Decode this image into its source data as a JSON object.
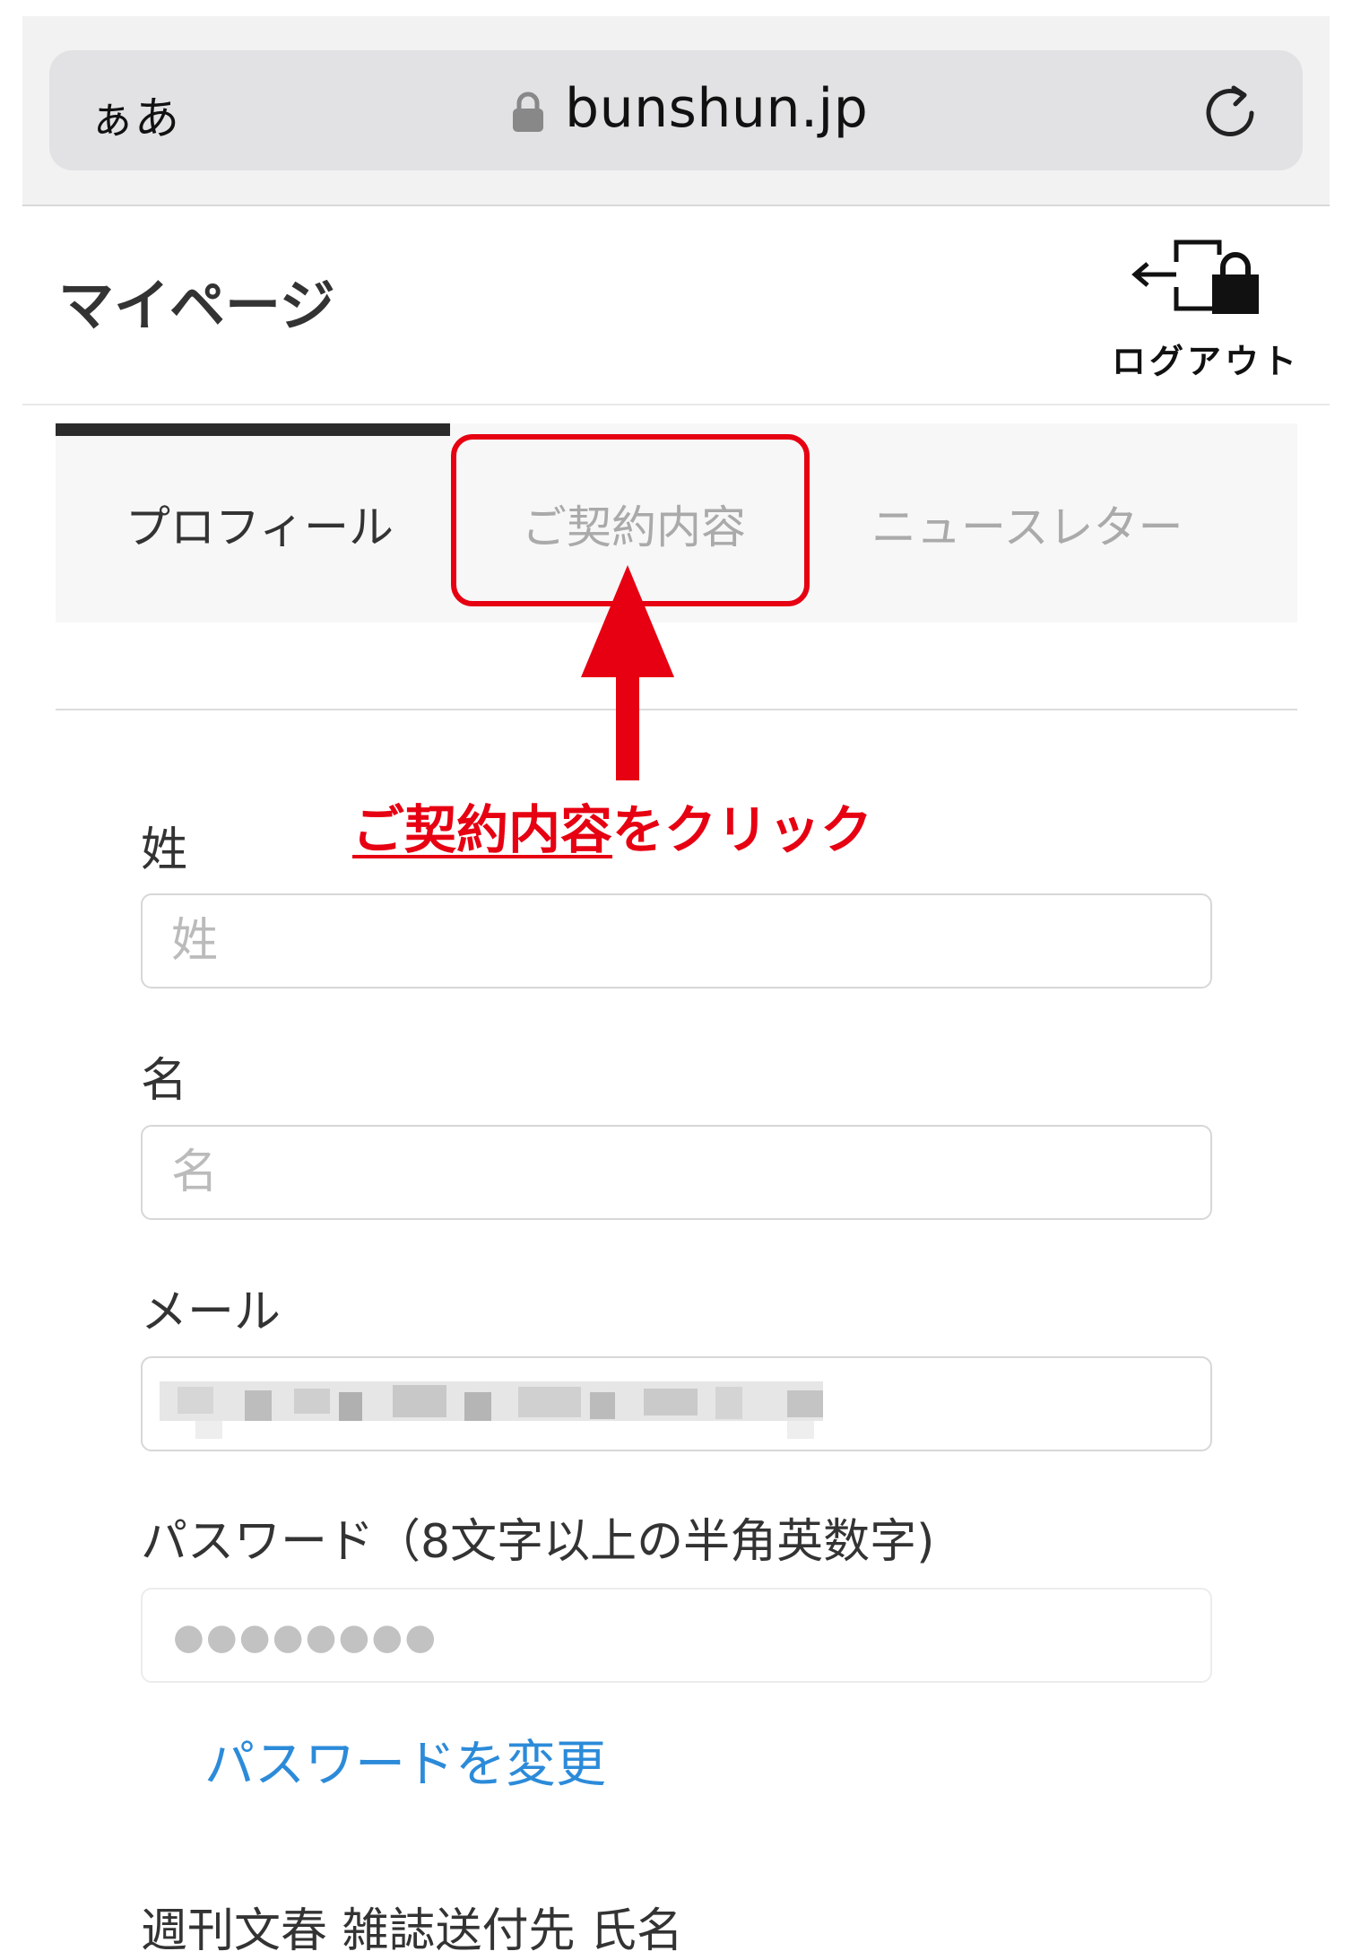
{
  "browser": {
    "text_size_label": "ぁあ",
    "url": "bunshun.jp"
  },
  "header": {
    "title": "マイページ",
    "logout_label": "ログアウト"
  },
  "tabs": [
    {
      "label": "プロフィール",
      "active": true
    },
    {
      "label": "ご契約内容",
      "active": false
    },
    {
      "label": "ニュースレター",
      "active": false
    }
  ],
  "annotation": {
    "highlight": "ご契約内容",
    "rest": "をクリック",
    "color": "#e60012"
  },
  "form": {
    "last_name": {
      "label": "姓",
      "placeholder": "姓"
    },
    "first_name": {
      "label": "名",
      "placeholder": "名"
    },
    "email": {
      "label": "メール"
    },
    "password": {
      "label": "パスワード（8文字以上の半角英数字)",
      "masked": "●●●●●●●●"
    },
    "change_password_link": "パスワードを変更",
    "next_section_label": "週刊文春 雑誌送付先 氏名"
  },
  "colors": {
    "link": "#2c8bd9",
    "accent": "#e60012"
  }
}
